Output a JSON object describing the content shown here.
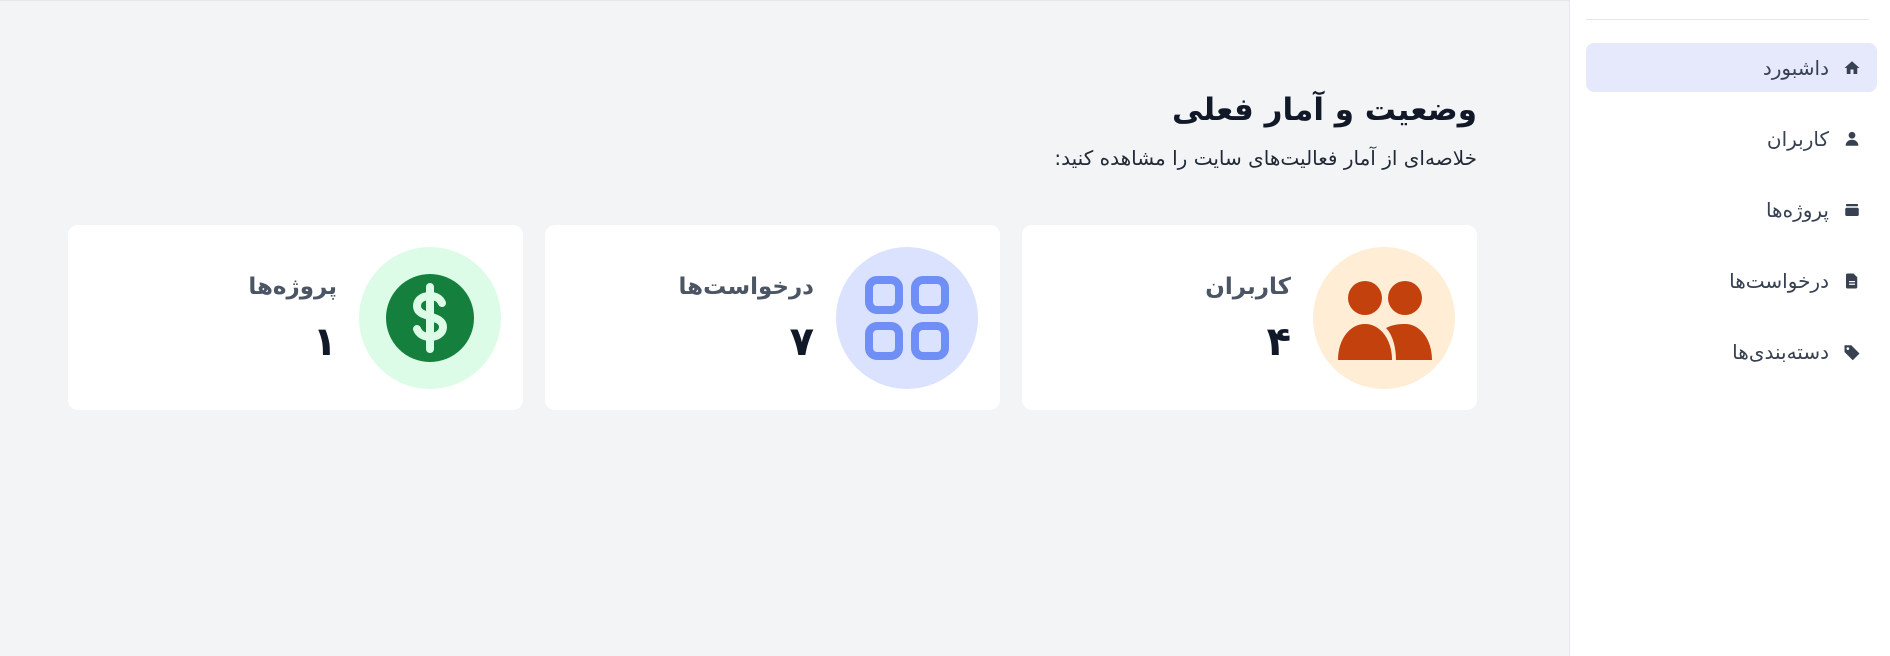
{
  "sidebar": {
    "items": [
      {
        "label": "داشبورد",
        "icon": "home-icon",
        "active": true
      },
      {
        "label": "کاربران",
        "icon": "user-icon",
        "active": false
      },
      {
        "label": "پروژه‌ها",
        "icon": "layers-icon",
        "active": false
      },
      {
        "label": "درخواست‌ها",
        "icon": "document-icon",
        "active": false
      },
      {
        "label": "دسته‌بندی‌ها",
        "icon": "tag-icon",
        "active": false
      }
    ]
  },
  "main": {
    "title": "وضعیت و آمار فعلی",
    "subtitle": "خلاصه‌ای از آمار فعالیت‌های سایت را مشاهده کنید:",
    "cards": [
      {
        "label": "کاربران",
        "value": "۴",
        "icon": "users-icon",
        "bg": "#ffedd5",
        "fg": "#c2410c"
      },
      {
        "label": "درخواست‌ها",
        "value": "۷",
        "icon": "grid-icon",
        "bg": "#dbe2fe",
        "fg": "#6f8ef6"
      },
      {
        "label": "پروژه‌ها",
        "value": "۱",
        "icon": "dollar-icon",
        "bg": "#dcfce7",
        "fg": "#15803d"
      }
    ]
  },
  "colors": {
    "active_nav_bg": "#e5e9fb",
    "page_bg": "#f3f4f6"
  }
}
